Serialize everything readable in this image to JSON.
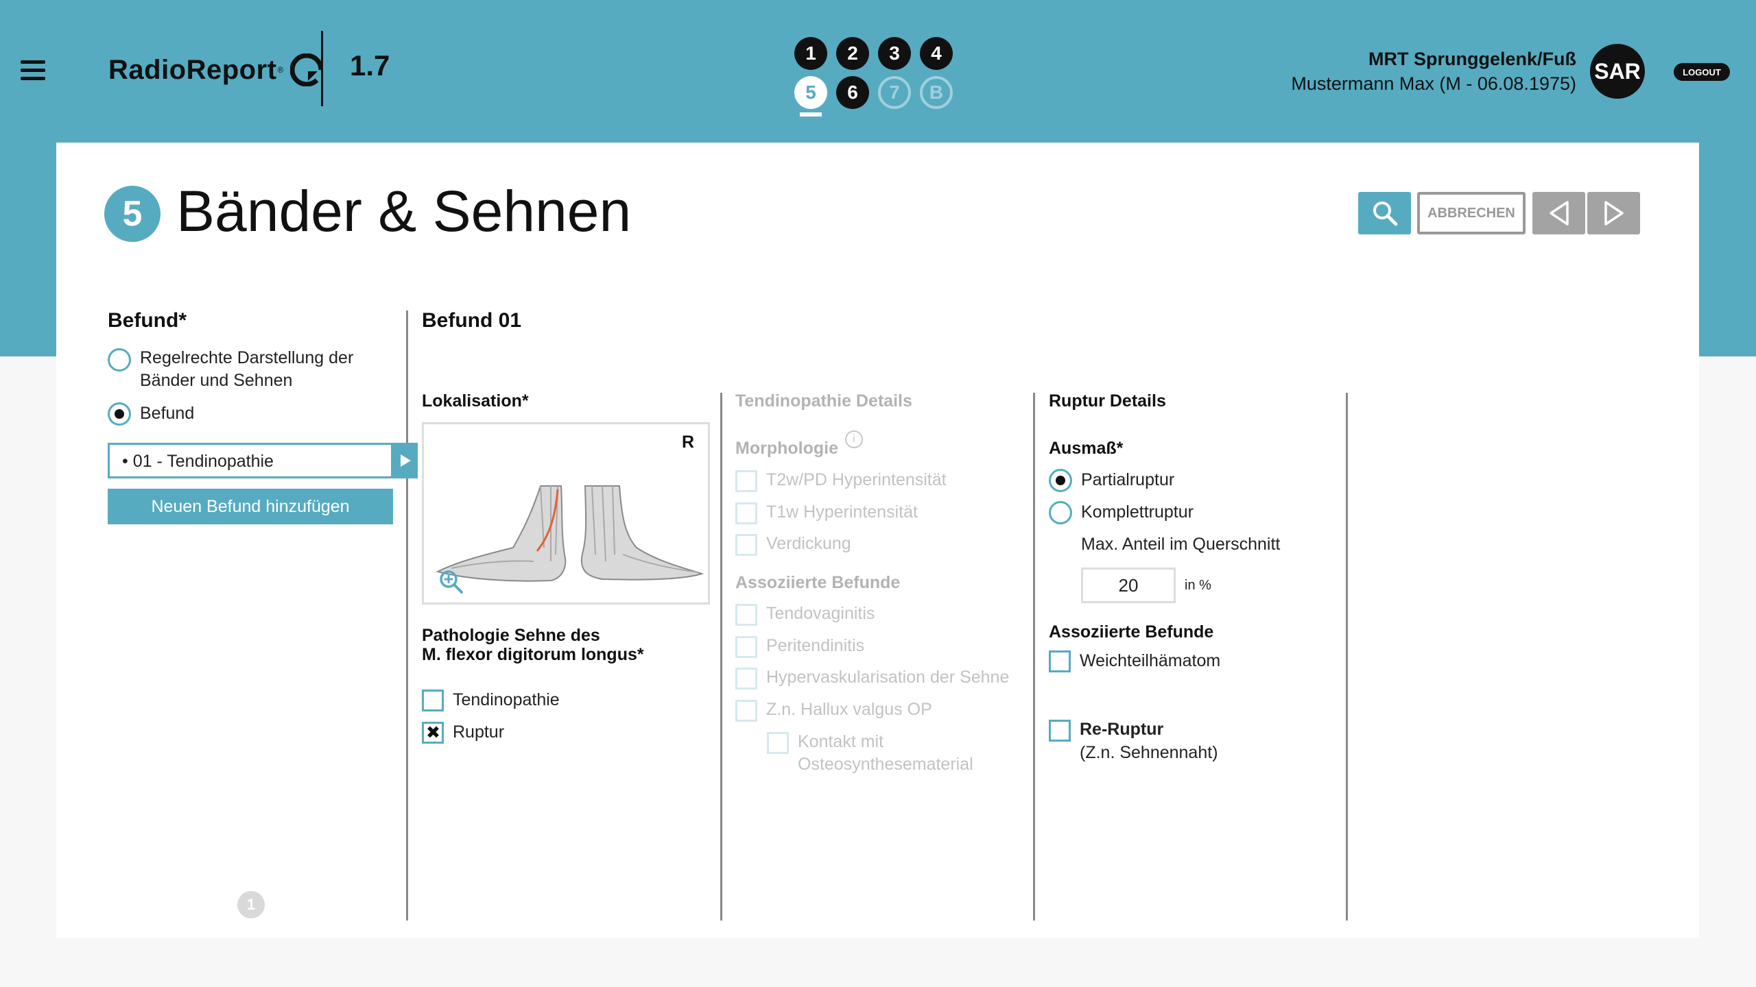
{
  "header": {
    "app_name": "RadioReport",
    "app_reg": "®",
    "version": "1.7",
    "steps": [
      "1",
      "2",
      "3",
      "4",
      "5",
      "6",
      "7",
      "B"
    ],
    "exam": "MRT Sprunggelenk/Fuß",
    "patient": "Mustermann Max (M - 06.08.1975)",
    "avatar": "SAR",
    "logout": "LOGOUT"
  },
  "section": {
    "number": "5",
    "title": "Bänder & Sehnen"
  },
  "toolbar": {
    "cancel": "ABBRECHEN"
  },
  "befund": {
    "heading": "Befund*",
    "option_normal": "Regelrechte Darstellung der Bänder und Sehnen",
    "option_befund": "Befund",
    "selected_item": "• 01 - Tendinopathie",
    "add_button": "Neuen Befund hinzufügen",
    "page_indicator": "1"
  },
  "befund01": {
    "heading": "Befund 01",
    "lokalisation": "Lokalisation*",
    "side_marker": "R",
    "pathologie_line1": "Pathologie Sehne des",
    "pathologie_line2": "M. flexor digitorum longus*",
    "opt_tendinopathie": "Tendinopathie",
    "opt_ruptur": "Ruptur"
  },
  "tendinopathie": {
    "heading": "Tendinopathie Details",
    "morphologie": "Morphologie",
    "info_icon": "i",
    "items": [
      "T2w/PD Hyperintensität",
      "T1w Hyperintensität",
      "Verdickung"
    ],
    "assoz_heading": "Assoziierte Befunde",
    "assoz_items": [
      "Tendovaginitis",
      "Peritendinitis",
      "Hypervaskularisation der Sehne",
      "Z.n. Hallux valgus OP"
    ],
    "sub_item_line1": "Kontakt mit",
    "sub_item_line2": "Osteosynthesematerial"
  },
  "ruptur": {
    "heading": "Ruptur Details",
    "ausmass": "Ausmaß*",
    "opt_partial": "Partialruptur",
    "opt_komplett": "Komplettruptur",
    "max_anteil": "Max. Anteil im Querschnitt",
    "value": "20",
    "unit": "in %",
    "assoz_heading": "Assoziierte Befunde",
    "weichteil": "Weichteilhämatom",
    "reruptur": "Re-Ruptur",
    "reruptur_sub": "(Z.n. Sehnennaht)"
  },
  "colors": {
    "accent": "#56abc1",
    "dark": "#111111",
    "grey": "#a3a3a3"
  }
}
